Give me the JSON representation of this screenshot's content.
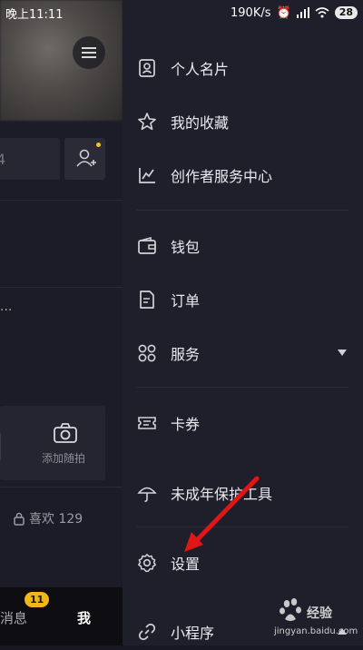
{
  "status_bar": {
    "time": "晚上11:11",
    "speed": "190K/s",
    "battery": "28"
  },
  "background_page": {
    "stat_digit": "4",
    "ellipsis": "...",
    "snap_label": "添加随拍",
    "likes_text": "喜欢 129",
    "nav_messages": "消息",
    "nav_badge": "11",
    "nav_me": "我"
  },
  "drawer": {
    "items": [
      {
        "label": "个人名片",
        "icon": "id-card-icon"
      },
      {
        "label": "我的收藏",
        "icon": "star-icon"
      },
      {
        "label": "创作者服务中心",
        "icon": "chart-line-icon"
      },
      {
        "label": "钱包",
        "icon": "wallet-icon"
      },
      {
        "label": "订单",
        "icon": "document-icon"
      },
      {
        "label": "服务",
        "icon": "grid-icon"
      },
      {
        "label": "卡券",
        "icon": "ticket-icon"
      },
      {
        "label": "未成年保护工具",
        "icon": "umbrella-icon"
      },
      {
        "label": "设置",
        "icon": "gear-icon"
      },
      {
        "label": "小程序",
        "icon": "link-icon"
      }
    ]
  },
  "watermark": {
    "text": "jingyan.baidu.com",
    "logo": "Baidu经验"
  },
  "colors": {
    "accent_badge": "#f0b817",
    "annotation_arrow": "#e01515",
    "drawer_bg": "#1e1f2b"
  }
}
